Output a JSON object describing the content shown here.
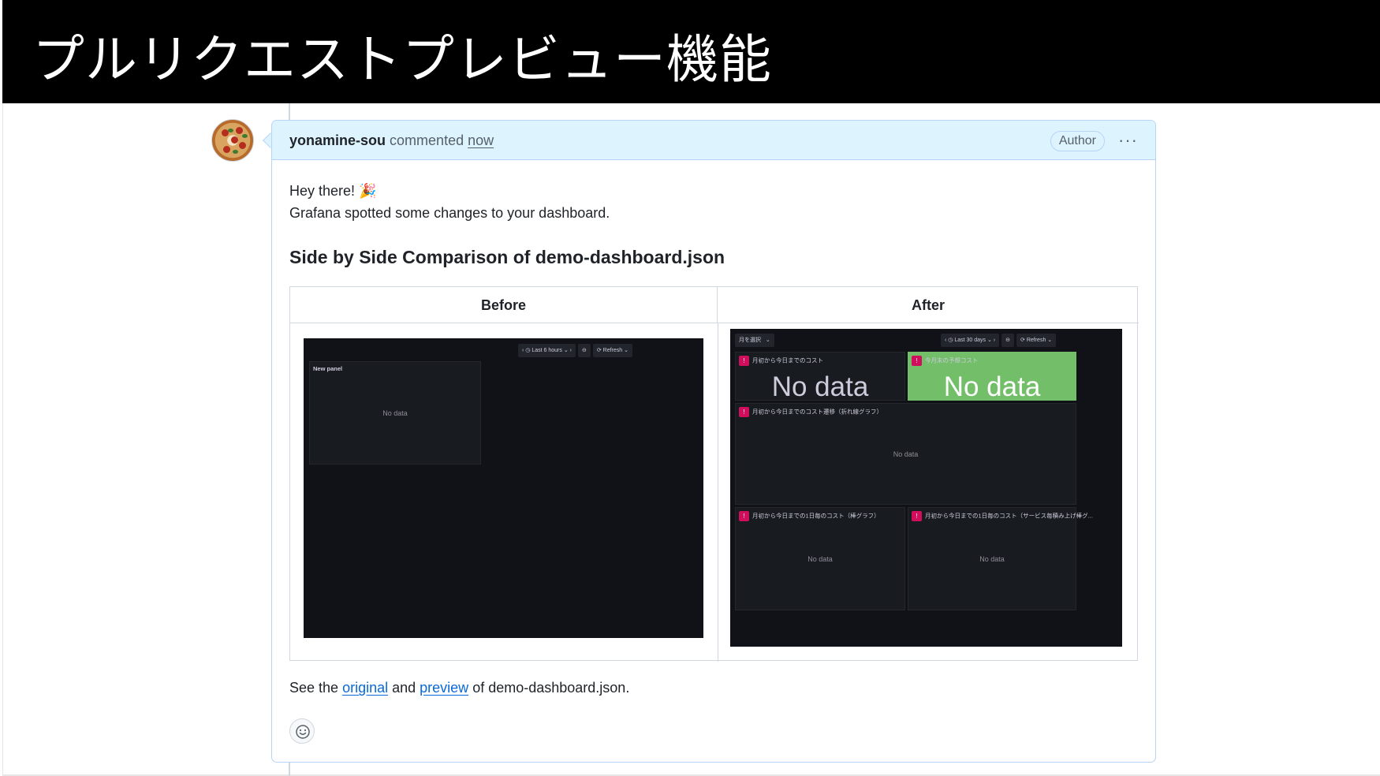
{
  "slide": {
    "title": "プルリクエストプレビュー機能"
  },
  "comment": {
    "author": "yonamine-sou",
    "action": "commented",
    "timestamp": "now",
    "badge": "Author",
    "more_icon": "kebab-horizontal-icon",
    "greeting_line1": "Hey there! 🎉",
    "greeting_line2": "Grafana spotted some changes to your dashboard.",
    "heading": "Side by Side Comparison of demo-dashboard.json",
    "table": {
      "headers": [
        "Before",
        "After"
      ]
    },
    "footer": {
      "prefix": "See the ",
      "link_original": "original",
      "middle": " and ",
      "link_preview": "preview",
      "suffix": " of demo-dashboard.json."
    },
    "reaction_icon": "smiley-icon"
  },
  "before_dashboard": {
    "toolbar": {
      "time_range": "Last 6 hours",
      "refresh": "Refresh"
    },
    "panel": {
      "title": "New panel",
      "value": "No data"
    }
  },
  "after_dashboard": {
    "variable_select": "月を選択",
    "toolbar": {
      "time_range": "Last 30 days",
      "refresh": "Refresh"
    },
    "panels": [
      {
        "title": "月初から今日までのコスト",
        "value": "No data"
      },
      {
        "title": "今月末の予想コスト",
        "value": "No data"
      },
      {
        "title": "月初から今日までのコスト遷移（折れ線グラフ）",
        "value": "No data"
      },
      {
        "title": "月初から今日までの1日毎のコスト（棒グラフ）",
        "value": "No data"
      },
      {
        "title": "月初から今日までの1日毎のコスト（サービス毎積み上げ棒グ...",
        "value": "No data"
      }
    ],
    "colors": {
      "background": "#111217",
      "panel": "#181b1f",
      "stat_green": "#73bf69",
      "warning": "#d10e5c"
    }
  }
}
